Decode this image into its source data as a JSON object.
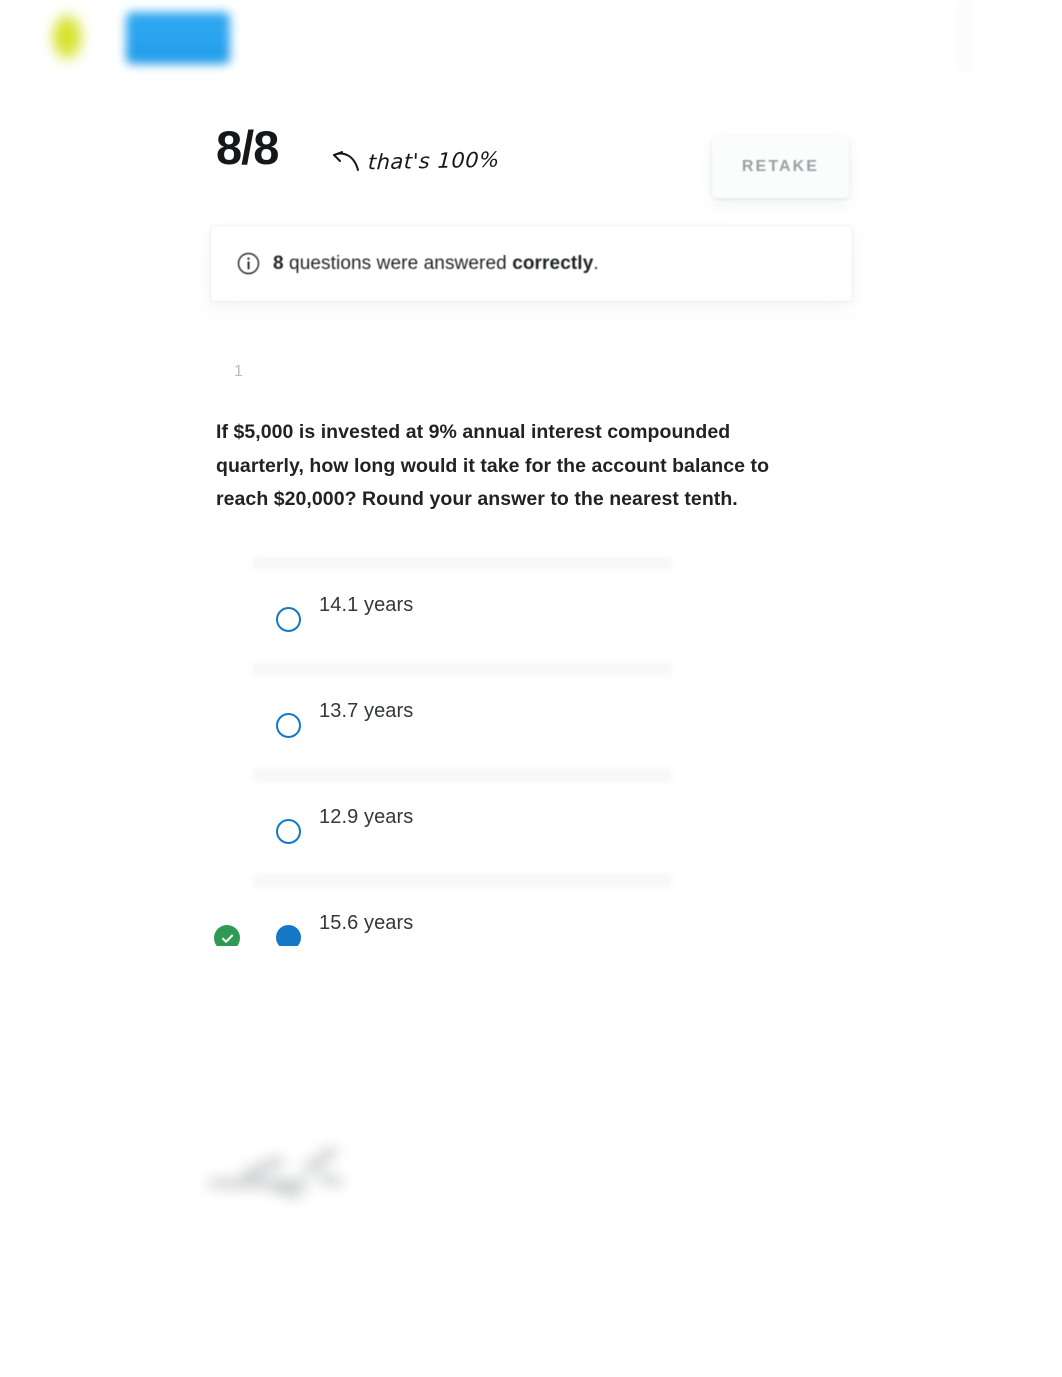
{
  "brand": {
    "logo_mark": "leaf-logo-mark",
    "logo_wordmark": "brand-wordmark"
  },
  "score": {
    "value": "8/8",
    "annotation": "that's 100%",
    "annotation_arrow": "curved-left-arrow-icon"
  },
  "retake": {
    "label": "RETAKE"
  },
  "banner": {
    "icon": "info-circle-icon",
    "count": "8",
    "middle_text": " questions were answered ",
    "emphasis": "correctly",
    "period": "."
  },
  "question": {
    "number": "1",
    "text": "If $5,000 is invested at 9% annual interest compounded quarterly, how long would it take for the account balance to reach $20,000? Round your answer to the nearest tenth.",
    "options": [
      {
        "label": "14.1 years",
        "selected": false,
        "correct": false
      },
      {
        "label": "13.7 years",
        "selected": false,
        "correct": false
      },
      {
        "label": "12.9 years",
        "selected": false,
        "correct": false
      },
      {
        "label": "15.6 years",
        "selected": true,
        "correct": true
      }
    ]
  },
  "colors": {
    "radio_blue": "#1478c6",
    "correct_green": "#2e9b55",
    "text_dark": "#1f2326",
    "muted_gray": "#b9bdc0",
    "retake_gray": "#9aa0a3"
  }
}
